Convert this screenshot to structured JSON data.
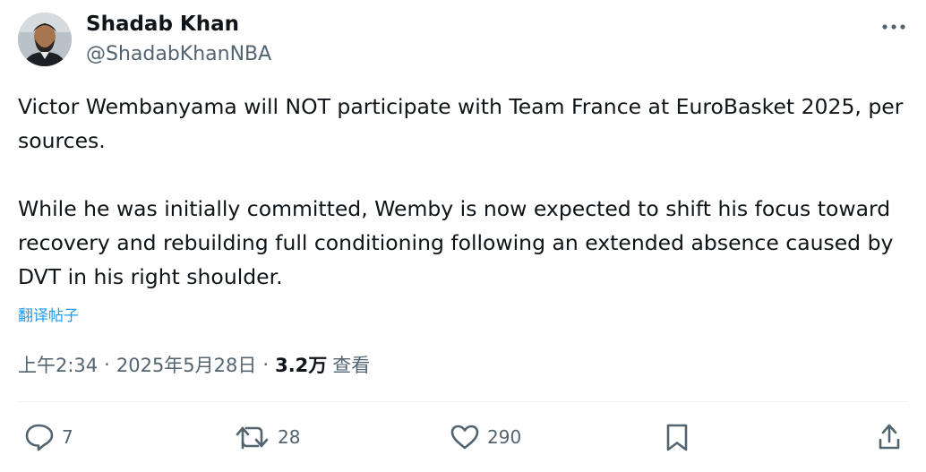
{
  "author": {
    "name": "Shadab Khan",
    "handle": "@ShadabKhanNBA"
  },
  "tweet": {
    "paragraphs": [
      "Victor Wembanyama will NOT participate with Team France at EuroBasket 2025, per sources.",
      "While he was initially committed, Wemby is now expected to shift his focus toward recovery and rebuilding full conditioning following an extended absence caused by DVT in his right shoulder."
    ],
    "translate_label": "翻译帖子"
  },
  "meta": {
    "time": "上午2:34",
    "date": "2025年5月28日",
    "views_count": "3.2万",
    "views_label": "查看",
    "separator": "·"
  },
  "actions": {
    "replies": "7",
    "reposts": "28",
    "likes": "290"
  },
  "colors": {
    "text": "#0f1419",
    "secondary": "#536471",
    "link": "#1d9bf0",
    "divider": "#eff3f4"
  },
  "icons": [
    "more-icon",
    "reply-icon",
    "repost-icon",
    "like-icon",
    "bookmark-icon",
    "share-icon"
  ]
}
